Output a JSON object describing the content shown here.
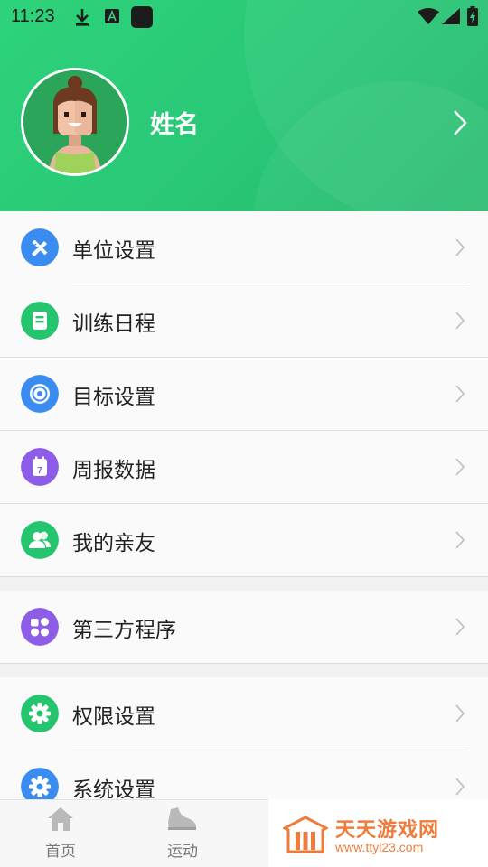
{
  "status_bar": {
    "time": "11:23"
  },
  "profile": {
    "name": "姓名"
  },
  "colors": {
    "brand_green": "#2ed37a",
    "text": "#222222",
    "chevron": "#c4c4c4"
  },
  "menu_sections": [
    {
      "items": [
        {
          "label": "单位设置",
          "icon": "ruler-pencil-icon",
          "color": "#3b8cf0"
        },
        {
          "label": "训练日程",
          "icon": "notebook-icon",
          "color": "#25c46e"
        },
        {
          "label": "目标设置",
          "icon": "target-icon",
          "color": "#3b8cf0"
        },
        {
          "label": "周报数据",
          "icon": "calendar-icon",
          "color": "#8e5de8"
        },
        {
          "label": "我的亲友",
          "icon": "friends-icon",
          "color": "#25c46e"
        }
      ]
    },
    {
      "items": [
        {
          "label": "第三方程序",
          "icon": "apps-icon",
          "color": "#8e5de8"
        }
      ]
    },
    {
      "items": [
        {
          "label": "权限设置",
          "icon": "gear-icon",
          "color": "#25c46e"
        },
        {
          "label": "系统设置",
          "icon": "settings-icon",
          "color": "#3b8cf0"
        }
      ]
    }
  ],
  "calendar_icon_day": "7",
  "bottom_nav": [
    {
      "label": "首页",
      "icon": "home-icon"
    },
    {
      "label": "运动",
      "icon": "shoe-icon"
    }
  ],
  "watermark": {
    "title": "天天游戏网",
    "url": "www.ttyl23.com"
  }
}
